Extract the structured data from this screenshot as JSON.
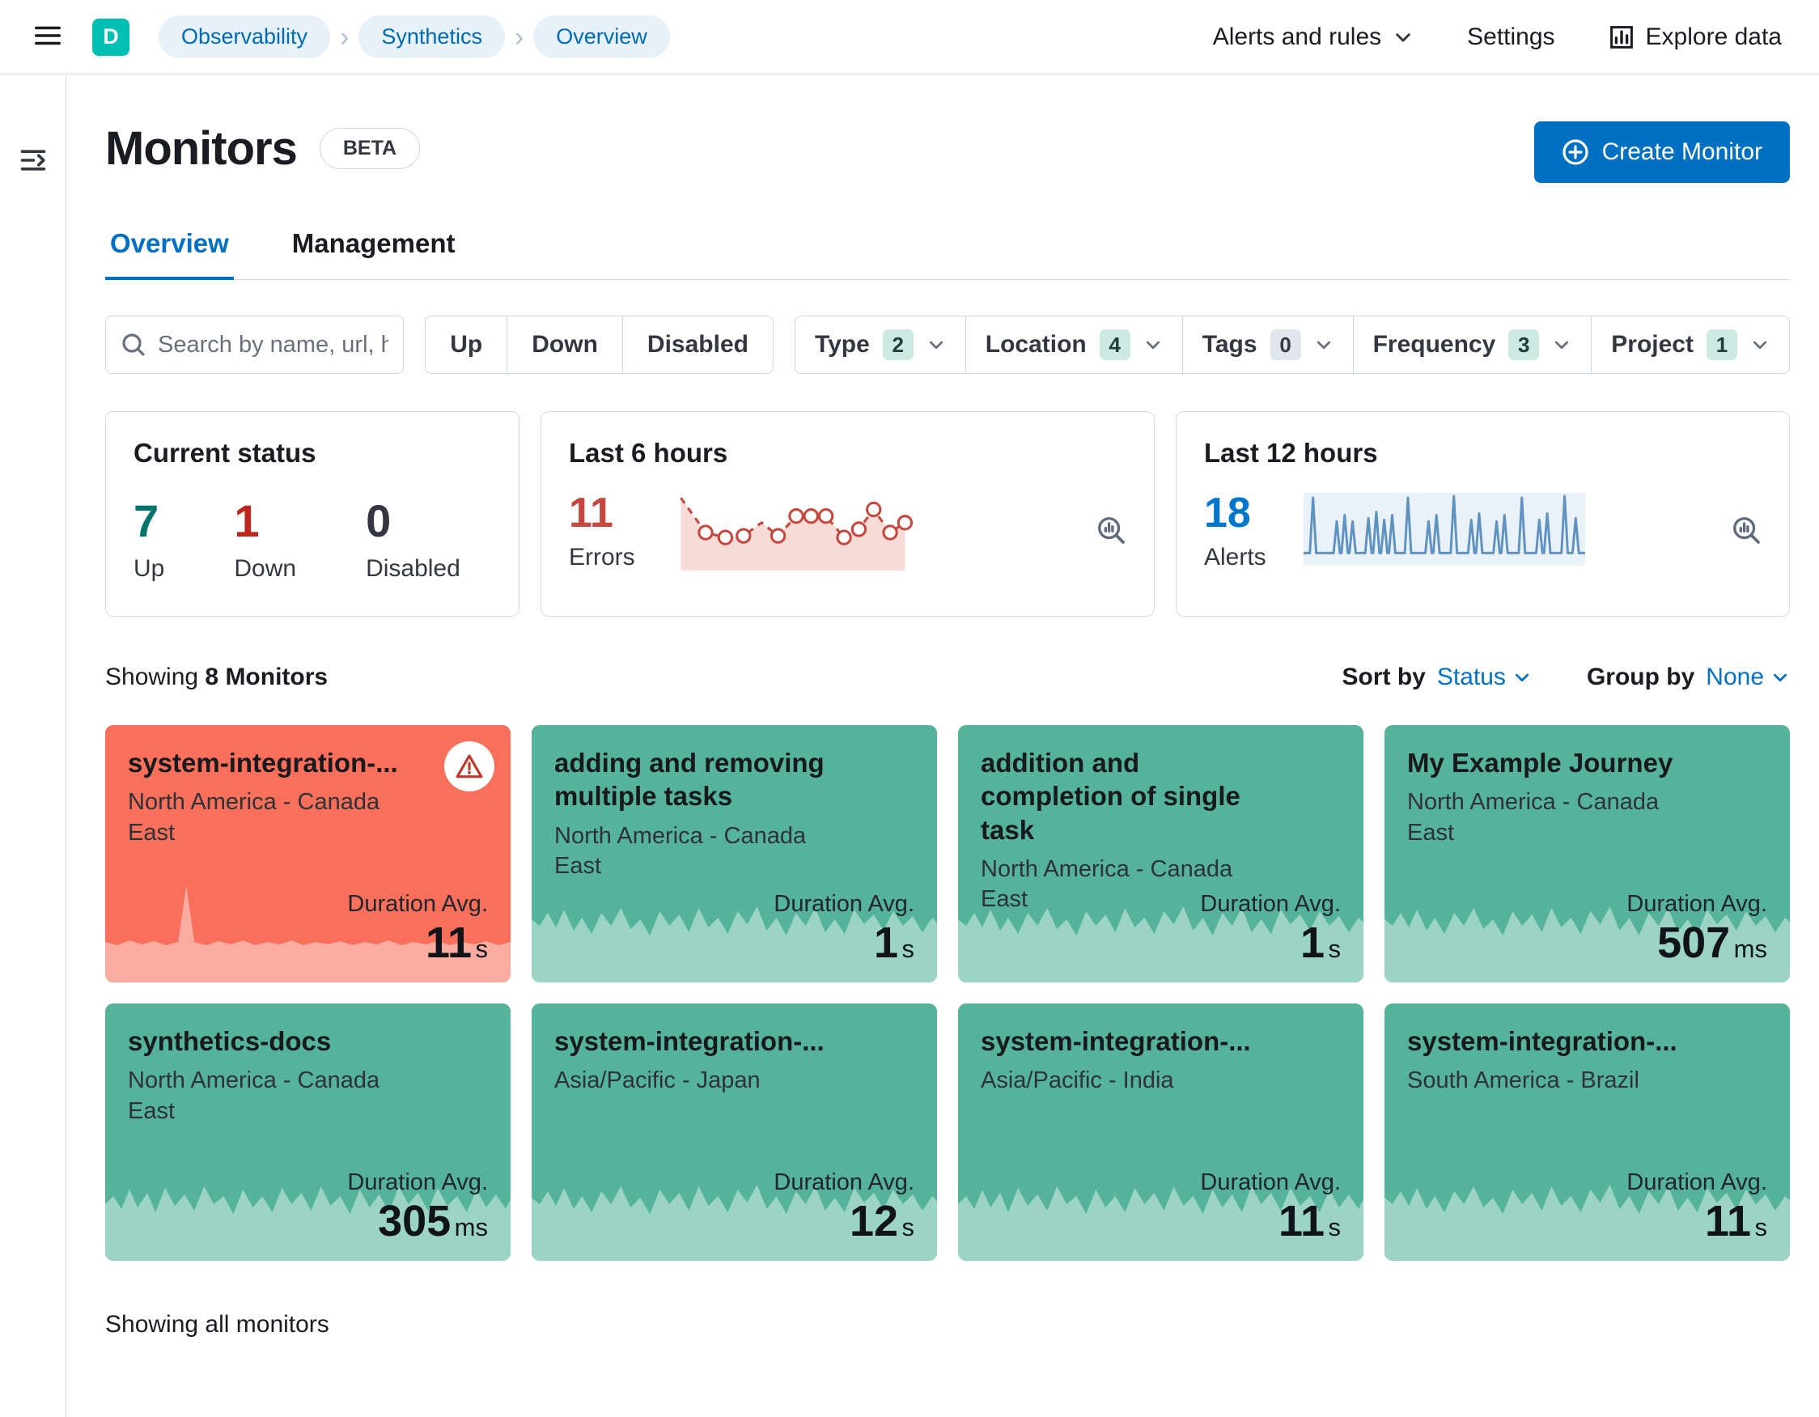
{
  "colors": {
    "accent_blue": "#0071c2",
    "brand_teal": "#00bfb3",
    "card_up_green": "#54b399",
    "card_down_red": "#f8705c",
    "up_text_green": "#00756b",
    "down_text_red": "#bd271e",
    "errors_red": "#c5473d",
    "alerts_blue": "#0077cc",
    "breadcrumb_bg": "#e6f1fa"
  },
  "icons": {
    "menu": "hamburger-menu",
    "collapse": "expand-sidebar",
    "search": "magnifier",
    "create": "plus-in-circle",
    "explore": "chart-frame",
    "inspect": "magnifier-with-bars",
    "warning": "alert-triangle",
    "chevron": "chevron-down"
  },
  "header": {
    "avatar": "D",
    "breadcrumbs": [
      "Observability",
      "Synthetics",
      "Overview"
    ],
    "nav": {
      "alerts": "Alerts and rules",
      "settings": "Settings",
      "explore": "Explore data"
    }
  },
  "page": {
    "title": "Monitors",
    "beta": "BETA",
    "create_button": "Create Monitor",
    "tabs": [
      {
        "label": "Overview"
      },
      {
        "label": "Management"
      }
    ],
    "search_placeholder": "Search by name, url, host, ta",
    "status_filters": [
      "Up",
      "Down",
      "Disabled"
    ],
    "filters": [
      {
        "label": "Type",
        "count": "2"
      },
      {
        "label": "Location",
        "count": "4"
      },
      {
        "label": "Tags",
        "count": "0"
      },
      {
        "label": "Frequency",
        "count": "3"
      },
      {
        "label": "Project",
        "count": "1"
      }
    ],
    "showing_prefix": "Showing",
    "showing_count": "8 Monitors",
    "sort_label": "Sort by",
    "sort_value": "Status",
    "group_label": "Group by",
    "group_value": "None",
    "footer": "Showing all monitors"
  },
  "panels": {
    "current_status": {
      "title": "Current status",
      "items": [
        {
          "value": "7",
          "label": "Up"
        },
        {
          "value": "1",
          "label": "Down"
        },
        {
          "value": "0",
          "label": "Disabled"
        }
      ]
    },
    "last6": {
      "title": "Last 6 hours",
      "value": "11",
      "label": "Errors"
    },
    "last12": {
      "title": "Last 12 hours",
      "value": "18",
      "label": "Alerts"
    }
  },
  "labels": {
    "duration_avg": "Duration Avg."
  },
  "monitors": [
    {
      "name": "system-integration-...",
      "location": "North America - Canada East",
      "duration": "11",
      "unit": "s",
      "status": "down"
    },
    {
      "name": "adding and removing multiple tasks",
      "location": "North America - Canada East",
      "duration": "1",
      "unit": "s",
      "status": "up"
    },
    {
      "name": "addition and completion of single task",
      "location": "North America - Canada East",
      "duration": "1",
      "unit": "s",
      "status": "up"
    },
    {
      "name": "My Example Journey",
      "location": "North America - Canada East",
      "duration": "507",
      "unit": "ms",
      "status": "up"
    },
    {
      "name": "synthetics-docs",
      "location": "North America - Canada East",
      "duration": "305",
      "unit": "ms",
      "status": "up"
    },
    {
      "name": "system-integration-...",
      "location": "Asia/Pacific - Japan",
      "duration": "12",
      "unit": "s",
      "status": "up"
    },
    {
      "name": "system-integration-...",
      "location": "Asia/Pacific - India",
      "duration": "11",
      "unit": "s",
      "status": "up"
    },
    {
      "name": "system-integration-...",
      "location": "South America - Brazil",
      "duration": "11",
      "unit": "s",
      "status": "up"
    }
  ]
}
